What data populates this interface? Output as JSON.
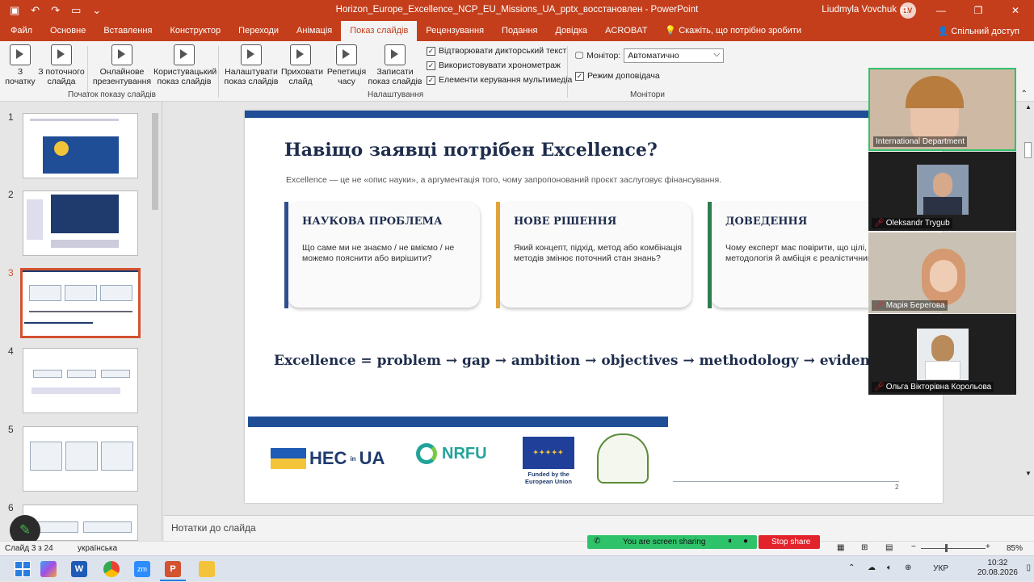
{
  "titlebar": {
    "document_title": "Horizon_Europe_Excellence_NCP_EU_Missions_UA_pptx_восстановлен - PowerPoint",
    "user_name": "Liudmyla Vovchuk",
    "user_initials": "LV"
  },
  "tabs": [
    "Файл",
    "Основне",
    "Вставлення",
    "Конструктор",
    "Переходи",
    "Анімація",
    "Показ слайдів",
    "Рецензування",
    "Подання",
    "Довідка",
    "ACROBAT"
  ],
  "active_tab": "Показ слайдів",
  "tell_me": "Скажіть, що потрібно зробити",
  "share_label": "Спільний доступ",
  "ribbon": {
    "from_beginning": "З початку",
    "from_current": "З поточного слайда",
    "online": "Онлайнове презентування",
    "custom_show": "Користувацький показ слайдів",
    "group_start": "Початок показу слайдів",
    "setup": "Налаштувати показ слайдів",
    "hide": "Приховати слайд",
    "rehearse": "Репетиція часу",
    "record": "Записати показ слайдів",
    "check_narration": "Відтворювати дикторський текст",
    "check_timings": "Використовувати хронометраж",
    "check_media": "Елементи керування мультимедіа",
    "group_setup": "Налаштування",
    "monitor_label": "Монітор:",
    "monitor_value": "Автоматично",
    "presenter_view": "Режим доповідача",
    "group_monitors": "Монітори"
  },
  "thumbnails": [
    "1",
    "2",
    "3",
    "4",
    "5",
    "6"
  ],
  "slide": {
    "title": "Навіщо заявці потрібен Excellence?",
    "subtitle": "Excellence — це не «опис науки», а аргументація того, чому запропонований проєкт заслуговує фінансування.",
    "cards": [
      {
        "title": "НАУКОВА ПРОБЛЕМА",
        "body": "Що саме ми не знаємо / не вміємо / не можемо пояснити або вирішити?",
        "color": "#2f4f8f"
      },
      {
        "title": "НОВЕ РІШЕННЯ",
        "body": "Який концепт, підхід, метод або комбінація методів змінює поточний стан знань?",
        "color": "#e0a43a"
      },
      {
        "title": "ДОВЕДЕННЯ",
        "body": "Чому експерт має повірити, що цілі, методологія й амбіція є реалістичними?",
        "color": "#2e7d4f"
      }
    ],
    "formula": "Excellence = problem → gap → ambition → objectives → methodology → evidence",
    "logo_heu": "HEC",
    "logo_heu_in": "in",
    "logo_heu_ua": "UA",
    "logo_nrfu": "NRFU",
    "logo_eu_caption": "Funded by the European Union",
    "page_number": "2"
  },
  "notes_placeholder": "Нотатки до слайда",
  "status": {
    "slide": "Слайд 3 з 24",
    "language": "українська",
    "zoom": "85%"
  },
  "sharing": {
    "text": "You are screen sharing",
    "stop": "Stop share"
  },
  "participants": [
    {
      "name": "International Department"
    },
    {
      "name": "Oleksandr Trygub"
    },
    {
      "name": "Марія Берегова"
    },
    {
      "name": "Ольга Вікторівна Корольова"
    }
  ],
  "tray": {
    "lang": "УКР",
    "time": "10:32",
    "date": "20.08.2026"
  }
}
